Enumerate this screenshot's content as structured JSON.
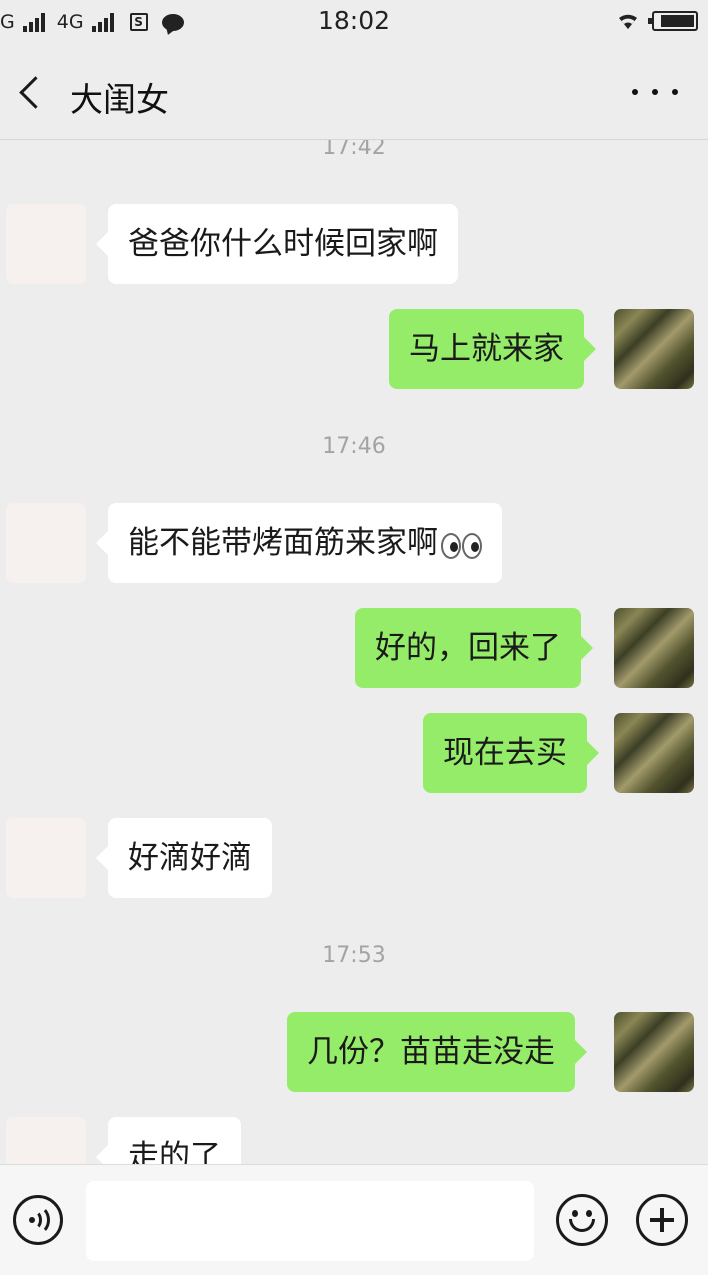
{
  "status_bar": {
    "carrier_1": "G",
    "carrier_2": "4G",
    "sim_label": "S",
    "time": "18:02"
  },
  "nav": {
    "title": "大闺女",
    "back_icon": "chevron-left-icon",
    "more_icon": "more-dots-icon"
  },
  "messages": [
    {
      "type": "timestamp",
      "text": "17:42"
    },
    {
      "type": "in",
      "text": "爸爸你什么时候回家啊"
    },
    {
      "type": "out",
      "text": "马上就来家"
    },
    {
      "type": "timestamp",
      "text": "17:46"
    },
    {
      "type": "in",
      "text": "能不能带烤面筋来家啊",
      "emoji": "eyes-emoji"
    },
    {
      "type": "out",
      "text": "好的，回来了"
    },
    {
      "type": "out",
      "text": "现在去买"
    },
    {
      "type": "in",
      "text": "好滴好滴"
    },
    {
      "type": "timestamp",
      "text": "17:53"
    },
    {
      "type": "out",
      "text": "几份？苗苗走没走"
    },
    {
      "type": "in",
      "text": "走的了"
    }
  ],
  "input_bar": {
    "voice_icon": "voice-icon",
    "input_value": "",
    "emoji_icon": "emoji-icon",
    "plus_icon": "plus-icon"
  },
  "colors": {
    "background": "#ededed",
    "outgoing_bubble": "#95ec69",
    "incoming_bubble": "#ffffff",
    "timestamp_text": "#a3a3a3"
  }
}
